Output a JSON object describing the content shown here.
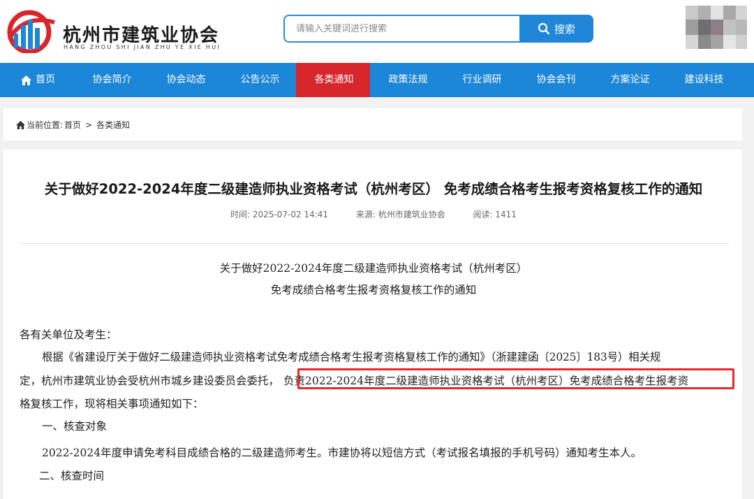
{
  "header": {
    "logo_title": "杭州市建筑业协会",
    "logo_subtitle": "HANG ZHOU SHI JIAN ZHU YE XIE HUI",
    "search_placeholder": "请输入关键词进行搜索",
    "search_button": "搜索",
    "search_icon": "search-icon"
  },
  "nav": {
    "items": [
      {
        "label": "首页",
        "icon": "home-icon"
      },
      {
        "label": "协会简介"
      },
      {
        "label": "协会动态"
      },
      {
        "label": "公告公示"
      },
      {
        "label": "各类通知",
        "active": true
      },
      {
        "label": "政策法规"
      },
      {
        "label": "行业调研"
      },
      {
        "label": "协会会刊"
      },
      {
        "label": "方案论证"
      },
      {
        "label": "建设科技"
      }
    ]
  },
  "breadcrumb": {
    "prefix": "当前位置:",
    "home": "首页",
    "separator": ">",
    "current": "各类通知"
  },
  "article": {
    "title": "关于做好2022-2024年度二级建造师执业资格考试（杭州考区） 免考成绩合格考生报考资格复核工作的通知",
    "time": "时间:  2025-07-02 14:41",
    "source": "来源: 杭州市建筑业协会",
    "reads": "阅读: 1411",
    "doc_title_line1": "关于做好2022-2024年度二级建造师执业资格考试（杭州考区）",
    "doc_title_line2": "免考成绩合格考生报考资格复核工作的通知",
    "salutation": "各有关单位及考生：",
    "para1_line1": "根据《省建设厅关于做好二级建造师执业资格考试免考成绩合格考生报考资格复核工作的通知》（浙建建函〔2025〕183号）相关规",
    "para1_line2_a": "定，杭州市建筑业协会受杭州市城乡建设委员会委托，",
    "para1_line2_b": "负责2022-2024年度二级建造师执业资格考试（杭州考区）免考成绩合格考生报考资",
    "para1_line3": "格复核工作，现将相关事项通知如下：",
    "section1": "一、核查对象",
    "section1_body": "2022-2024年度申请免考科目成绩合格的二级建造师考生。市建协将以短信方式（考试报名填报的手机号码）通知考生本人。",
    "section2": "二、核查时间"
  },
  "colors": {
    "nav_bg": "#1c86d8",
    "nav_active": "#d7262c",
    "highlight_border": "#e8262b"
  }
}
